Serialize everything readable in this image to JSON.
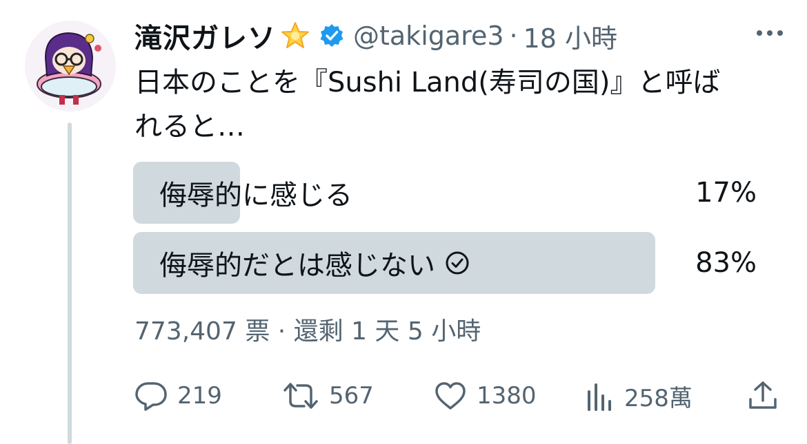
{
  "tweet": {
    "display_name": "滝沢ガレソ",
    "handle": "@takigare3",
    "separator": "·",
    "time": "18 小時",
    "text_line1": "日本のことを『Sushi Land(寿司の国)』と呼ば",
    "text_line2": "れると…"
  },
  "poll": {
    "options": [
      {
        "label": "侮辱的に感じる",
        "percent": "17%",
        "fraction": 0.17,
        "selected": false
      },
      {
        "label": "侮辱的だとは感じない",
        "percent": "83%",
        "fraction": 0.83,
        "selected": true
      }
    ],
    "meta": "773,407 票 · 還剩 1 天 5 小時"
  },
  "actions": {
    "replies": "219",
    "retweets": "567",
    "likes": "1380",
    "views": "258萬"
  },
  "icons": {
    "verified": "verified-badge-icon",
    "star": "star-emoji-icon",
    "more": "more-icon",
    "reply": "reply-icon",
    "retweet": "retweet-icon",
    "like": "heart-icon",
    "views": "views-icon",
    "share": "share-icon",
    "check": "check-circle-icon"
  },
  "colors": {
    "verified_blue": "#1d9bf0",
    "poll_bar": "#cfd9de",
    "secondary_text": "#536471"
  }
}
